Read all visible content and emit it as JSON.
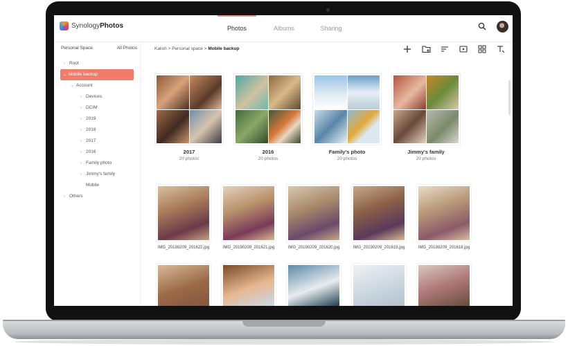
{
  "app": {
    "brand_light": "Synology",
    "brand_bold": "Photos"
  },
  "tabs": [
    {
      "label": "Photos",
      "active": true
    },
    {
      "label": "Albums",
      "active": false
    },
    {
      "label": "Sharing",
      "active": false
    }
  ],
  "sidebar": {
    "personal_space": "Personal Space",
    "all_photos": "All Photos",
    "items": [
      {
        "label": "Root",
        "chev": "›"
      },
      {
        "label": "Mobile backup",
        "chev": "⌄"
      },
      {
        "label": "Account",
        "chev": "⌄"
      },
      {
        "label": "Devices",
        "chev": "›"
      },
      {
        "label": "DCIM",
        "chev": "›"
      },
      {
        "label": "2019",
        "chev": "›"
      },
      {
        "label": "2018",
        "chev": "›"
      },
      {
        "label": "2017",
        "chev": "›"
      },
      {
        "label": "2016",
        "chev": "›"
      },
      {
        "label": "Family photo",
        "chev": "›"
      },
      {
        "label": "Jimmy's family",
        "chev": "›"
      },
      {
        "label": "Mobile",
        "chev": ""
      },
      {
        "label": "Others",
        "chev": "›"
      }
    ]
  },
  "breadcrumb": {
    "path": "Kalish > Personal space > ",
    "current": "Mobile backup"
  },
  "albums": [
    {
      "name": "2017",
      "count": "20 photos"
    },
    {
      "name": "2016",
      "count": "20 photos"
    },
    {
      "name": "Family's photo",
      "count": "20 photos"
    },
    {
      "name": "Jimmy's family",
      "count": "20 photos"
    }
  ],
  "photos": [
    {
      "name": "IMG_20190209_201622.jpg"
    },
    {
      "name": "IMG_20190209_201621.jpg"
    },
    {
      "name": "IMG_20190209_201620.jpg"
    },
    {
      "name": "IMG_20190209_201619.jpg"
    },
    {
      "name": "IMG_20190209_201618.jpg"
    }
  ],
  "colors": {
    "accent": "#f27c6a",
    "tab_indicator": "#f38f7a"
  },
  "icons": {
    "search": "search-icon",
    "toolbar": [
      "add-icon",
      "new-folder-icon",
      "sort-icon",
      "slideshow-icon",
      "view-grid-icon",
      "filter-icon"
    ]
  }
}
